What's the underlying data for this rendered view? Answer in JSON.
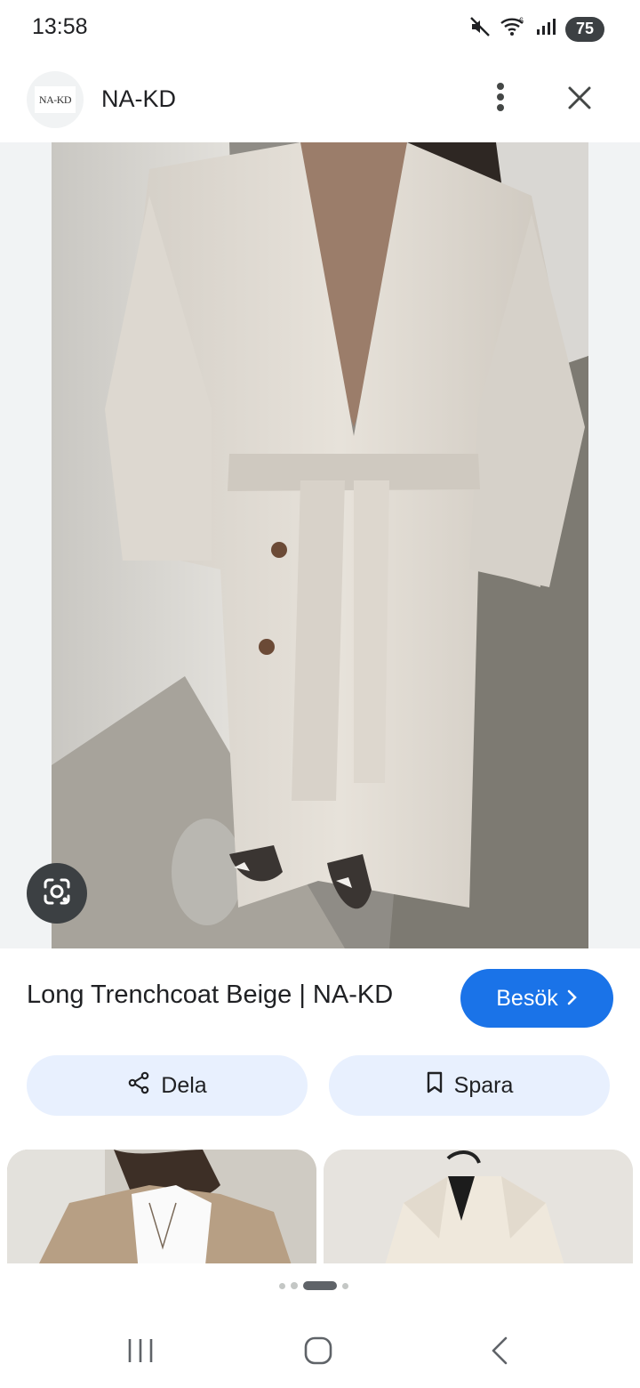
{
  "status_bar": {
    "time": "13:58",
    "battery": "75",
    "network_badge": "6"
  },
  "header": {
    "logo_text": "NA-KD",
    "site_name": "NA-KD"
  },
  "main": {
    "title": "Long Trenchcoat Beige | NA-KD",
    "visit_label": "Besök",
    "share_label": "Dela",
    "save_label": "Spara"
  },
  "icons": {
    "menu": "more-vert-icon",
    "close": "close-icon",
    "lens": "google-lens-icon",
    "share": "share-icon",
    "save": "bookmark-icon",
    "visit": "chevron-right-icon"
  },
  "colors": {
    "accent": "#1a73e8",
    "pill_bg": "#e8f0fe",
    "text": "#202124"
  }
}
